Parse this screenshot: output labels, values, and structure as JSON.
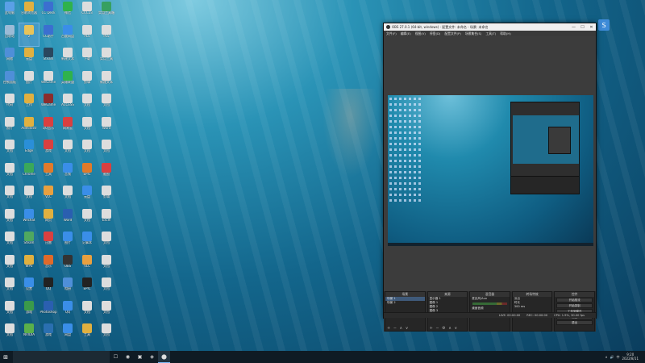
{
  "desktop": {
    "icons": [
      {
        "label": "此电脑",
        "color": "#5aa0e6"
      },
      {
        "label": "谷歌浏览器",
        "color": "#e0b040"
      },
      {
        "label": "CC Desk",
        "color": "#3b6fd0"
      },
      {
        "label": "微信",
        "color": "#2fb24c"
      },
      {
        "label": "CCC23",
        "color": "#dddddd"
      },
      {
        "label": "实用工具箱",
        "color": "#37a060"
      },
      {
        "label": "回收站",
        "color": "#9bbbd6"
      },
      {
        "label": "2",
        "color": "#e8c35a"
      },
      {
        "label": "CC助手",
        "color": "#3b6fd0"
      },
      {
        "label": "百度网盘",
        "color": "#3a8ee8"
      },
      {
        "label": "PLS",
        "color": "#dddddd"
      },
      {
        "label": "PLS",
        "color": "#dddddd"
      },
      {
        "label": "网络",
        "color": "#4f8fd8"
      },
      {
        "label": "云盘",
        "color": "#e0b040"
      },
      {
        "label": "Steam",
        "color": "#2a475e"
      },
      {
        "label": "新建文本",
        "color": "#dddddd"
      },
      {
        "label": "下载",
        "color": "#dddddd"
      },
      {
        "label": "实用工具",
        "color": "#dddddd"
      },
      {
        "label": "控制面板",
        "color": "#4f8fd8"
      },
      {
        "label": "图片",
        "color": "#dddddd"
      },
      {
        "label": "WeGame",
        "color": "#dddddd"
      },
      {
        "label": "英雄联盟",
        "color": "#2fb24c"
      },
      {
        "label": "剪辑",
        "color": "#dddddd"
      },
      {
        "label": "新建文本",
        "color": "#dddddd"
      },
      {
        "label": "代码",
        "color": "#dddddd"
      },
      {
        "label": "工作",
        "color": "#e0b040"
      },
      {
        "label": "WeGame",
        "color": "#8b2d2d"
      },
      {
        "label": "ACCESS",
        "color": "#dddddd"
      },
      {
        "label": "文档",
        "color": "#dddddd"
      },
      {
        "label": "文档",
        "color": "#dddddd"
      },
      {
        "label": "照片",
        "color": "#dddddd"
      },
      {
        "label": "Administr",
        "color": "#e0b040"
      },
      {
        "label": "QQ音乐",
        "color": "#d94040"
      },
      {
        "label": "网易云",
        "color": "#d94040"
      },
      {
        "label": "文档",
        "color": "#dddddd"
      },
      {
        "label": "Word",
        "color": "#dddddd"
      },
      {
        "label": "文档",
        "color": "#dddddd"
      },
      {
        "label": "Edge",
        "color": "#2a8fd8"
      },
      {
        "label": "游戏",
        "color": "#d94040"
      },
      {
        "label": "文档",
        "color": "#dddddd"
      },
      {
        "label": "文档",
        "color": "#dddddd"
      },
      {
        "label": "文档",
        "color": "#dddddd"
      },
      {
        "label": "文档",
        "color": "#dddddd"
      },
      {
        "label": "Chrome",
        "color": "#3aa85a"
      },
      {
        "label": "工具",
        "color": "#e07a2a"
      },
      {
        "label": "音频",
        "color": "#3a8ee8"
      },
      {
        "label": "EPIC",
        "color": "#e07a2a"
      },
      {
        "label": "截图",
        "color": "#d94040"
      },
      {
        "label": "文档",
        "color": "#dddddd"
      },
      {
        "label": "文档",
        "color": "#dddddd"
      },
      {
        "label": "VLC",
        "color": "#e8a040"
      },
      {
        "label": "文档",
        "color": "#dddddd"
      },
      {
        "label": "云盘",
        "color": "#3a8ee8"
      },
      {
        "label": "剪辑",
        "color": "#dddddd"
      },
      {
        "label": "文档",
        "color": "#dddddd"
      },
      {
        "label": "Wechat",
        "color": "#3a8ee8"
      },
      {
        "label": "网页",
        "color": "#e0b040"
      },
      {
        "label": "Word",
        "color": "#2a5fb0"
      },
      {
        "label": "文档",
        "color": "#dddddd"
      },
      {
        "label": "Excel",
        "color": "#dddddd"
      },
      {
        "label": "文档",
        "color": "#dddddd"
      },
      {
        "label": "Steam",
        "color": "#4fa860"
      },
      {
        "label": "迅雷",
        "color": "#d94040"
      },
      {
        "label": "图片",
        "color": "#3a8ee8"
      },
      {
        "label": "记事本",
        "color": "#3a8ee8"
      },
      {
        "label": "文档",
        "color": "#dddddd"
      },
      {
        "label": "文档",
        "color": "#dddddd"
      },
      {
        "label": "WPS",
        "color": "#e0b040"
      },
      {
        "label": "音乐",
        "color": "#e06a2a"
      },
      {
        "label": "OBS",
        "color": "#333333"
      },
      {
        "label": "VLC",
        "color": "#e8a040"
      },
      {
        "label": "文档",
        "color": "#dddddd"
      },
      {
        "label": "文档",
        "color": "#dddddd"
      },
      {
        "label": "设置",
        "color": "#3a8ee8"
      },
      {
        "label": "QQ",
        "color": "#222222"
      },
      {
        "label": "相册",
        "color": "#4f8fd8"
      },
      {
        "label": "EPIC",
        "color": "#222222"
      },
      {
        "label": "文档",
        "color": "#dddddd"
      },
      {
        "label": "文档",
        "color": "#dddddd"
      },
      {
        "label": "游戏",
        "color": "#3a9a4a"
      },
      {
        "label": "Photoshop",
        "color": "#2a5fb0"
      },
      {
        "label": "QQ",
        "color": "#3a8ee8"
      },
      {
        "label": "文档",
        "color": "#dddddd"
      },
      {
        "label": "文档",
        "color": "#dddddd"
      },
      {
        "label": "文档",
        "color": "#dddddd"
      },
      {
        "label": "NVIDIA",
        "color": "#5ab04a"
      },
      {
        "label": "游戏",
        "color": "#2a6fb0"
      },
      {
        "label": "网盘",
        "color": "#3a8ee8"
      },
      {
        "label": "工具",
        "color": "#e0b040"
      },
      {
        "label": "文档",
        "color": "#dddddd"
      }
    ]
  },
  "obs": {
    "title": "OBS 27.0.1 (64-bit, windows) - 配置文件: 未命名 - 场景: 未命名",
    "menu": [
      "文件(F)",
      "编辑(E)",
      "视图(V)",
      "停靠(D)",
      "配置文件(P)",
      "场景集合(S)",
      "工具(T)",
      "帮助(H)"
    ],
    "window_buttons": [
      "—",
      "☐",
      "✕"
    ],
    "docks": {
      "scenes": {
        "title": "场景",
        "items": [
          "场景 1",
          "场景 2"
        ]
      },
      "sources": {
        "title": "来源",
        "items": [
          "显示器 1",
          "图像 1",
          "图像 2",
          "图像 3",
          "图像 4"
        ]
      },
      "mixer": {
        "title": "混音器",
        "channels": [
          "麦克风/Aux",
          "桌面音频"
        ]
      },
      "transitions": {
        "title": "转场特效",
        "mode": "淡出",
        "duration_label": "时长",
        "duration": "300 ms"
      },
      "controls": {
        "title": "控件",
        "buttons": [
          "开始推流",
          "开始录制",
          "工作室模式",
          "设置",
          "退出"
        ]
      }
    },
    "status": {
      "live": "LIVE: 00:00:00",
      "rec": "REC: 00:00:00",
      "cpu": "CPU: 1.9%, 30.00 fps"
    }
  },
  "taskbar": {
    "start_glyph": "⊞",
    "apps": [
      "☐",
      "◉",
      "▣",
      "◈",
      "⬤"
    ],
    "tray": [
      "∧",
      "🔊",
      "中"
    ],
    "time": "9:20",
    "date": "2022/8/11"
  },
  "colors": {
    "accent": "#3d8bd8",
    "obs_bg": "#2b2b2b",
    "taskbar": "#0f1b24"
  }
}
